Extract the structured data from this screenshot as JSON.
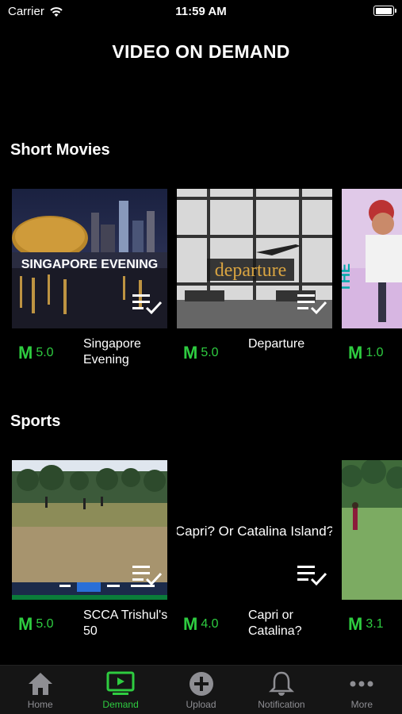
{
  "status": {
    "carrier": "Carrier",
    "time": "11:59 AM"
  },
  "header": {
    "title": "VIDEO ON DEMAND"
  },
  "sections": [
    {
      "title": "Short Movies",
      "items": [
        {
          "title": "Singapore Evening",
          "rating": "5.0",
          "thumb_text": "SINGAPORE EVENING"
        },
        {
          "title": "Departure",
          "rating": "5.0",
          "thumb_text": "departure"
        },
        {
          "title": "",
          "rating": "1.0",
          "thumb_text": ""
        }
      ]
    },
    {
      "title": "Sports",
      "items": [
        {
          "title": "SCCA Trishul's 50",
          "rating": "5.0",
          "thumb_text": ""
        },
        {
          "title": "Capri or Catalina?",
          "rating": "4.0",
          "thumb_text": "Capri? Or Catalina Island?"
        },
        {
          "title": "",
          "rating": "3.1",
          "thumb_text": ""
        }
      ]
    }
  ],
  "tabs": [
    {
      "label": "Home",
      "icon": "home-icon"
    },
    {
      "label": "Demand",
      "icon": "tv-icon",
      "active": true
    },
    {
      "label": "Upload",
      "icon": "plus-circle-icon"
    },
    {
      "label": "Notification",
      "icon": "bell-icon"
    },
    {
      "label": "More",
      "icon": "more-icon"
    }
  ],
  "colors": {
    "accent": "#2ecc40",
    "background": "#000000",
    "tab_inactive": "#8e8e93"
  }
}
